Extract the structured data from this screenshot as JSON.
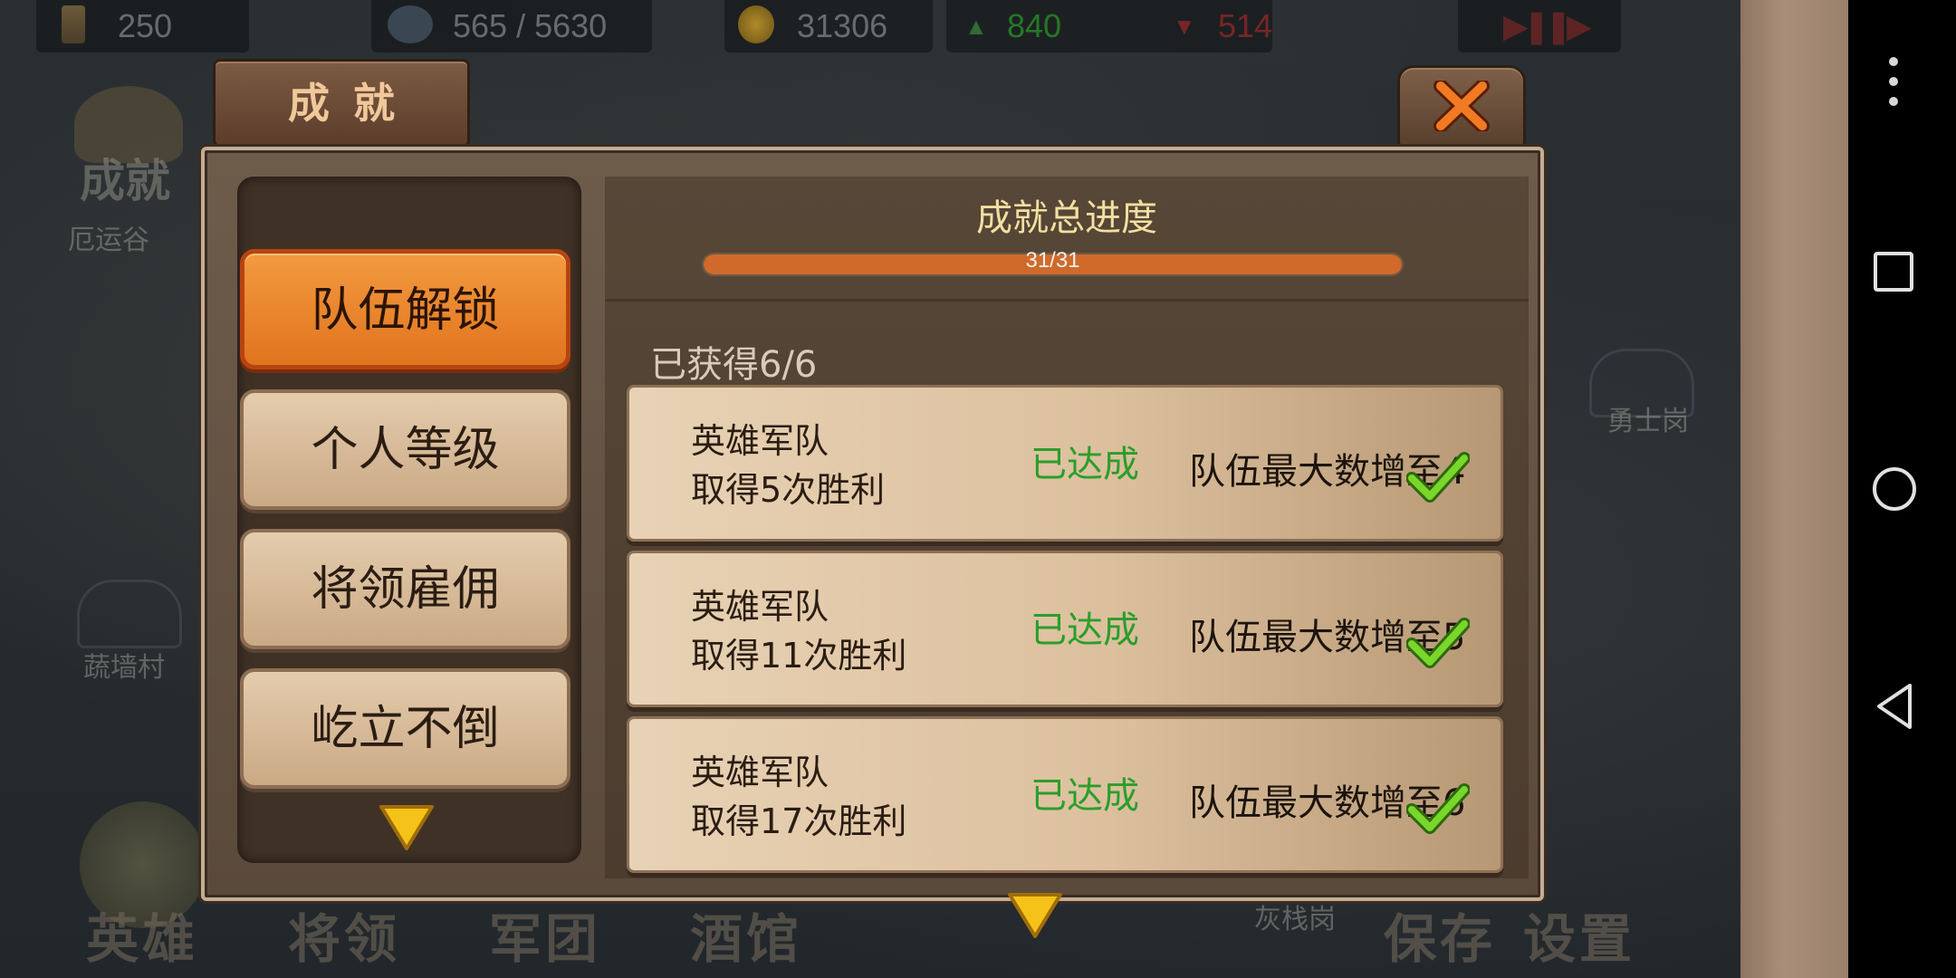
{
  "hud": {
    "time_value": "250",
    "population_value": "565 / 5630",
    "gold_value": "31306",
    "up_value": "840",
    "down_value": "514"
  },
  "background": {
    "achievement_label": "成就",
    "achievement_sublabel": "厄运谷",
    "map_labels": [
      "勇士岗",
      "蔬墙村",
      "灰栈岗"
    ],
    "bottom_buttons": [
      "英雄",
      "将领",
      "军团",
      "酒馆",
      "保存",
      "设置"
    ]
  },
  "dialog": {
    "title": "成就",
    "progress_title": "成就总进度",
    "progress_text": "31/31",
    "progress_fraction": 1.0,
    "obtained_label": "已获得6/6",
    "categories": [
      {
        "label": "队伍解锁",
        "active": true
      },
      {
        "label": "个人等级",
        "active": false
      },
      {
        "label": "将领雇佣",
        "active": false
      },
      {
        "label": "屹立不倒",
        "active": false
      }
    ],
    "achievements": [
      {
        "line1": "英雄军队",
        "line2": "取得5次胜利",
        "status": "已达成",
        "reward": "队伍最大数增至4"
      },
      {
        "line1": "英雄军队",
        "line2": "取得11次胜利",
        "status": "已达成",
        "reward": "队伍最大数增至5"
      },
      {
        "line1": "英雄军队",
        "line2": "取得17次胜利",
        "status": "已达成",
        "reward": "队伍最大数增至6"
      }
    ]
  },
  "colors": {
    "accent": "#e0741e",
    "status_green": "#2b9e2b",
    "check_green": "#7ad62a"
  }
}
